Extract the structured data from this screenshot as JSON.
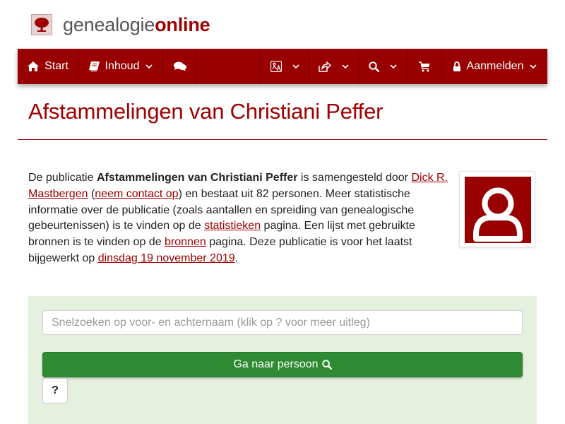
{
  "brand": {
    "part1": "genealogie",
    "part2": "online"
  },
  "nav": {
    "start": "Start",
    "inhoud": "Inhoud",
    "aanmelden": "Aanmelden",
    "icons": [
      "home-icon",
      "book-icon",
      "comments-icon",
      "language-icon",
      "share-icon",
      "search-icon",
      "cart-icon",
      "lock-icon"
    ]
  },
  "page": {
    "title": "Afstammelingen van Christiani Peffer"
  },
  "intro": {
    "t1": "De publicatie ",
    "pub_name": "Afstammelingen van Christiani Peffer",
    "t2": " is samengesteld door ",
    "author": "Dick R. Mastbergen",
    "t3": " (",
    "contact": "neem contact op",
    "t4": ") en bestaat uit 82 personen. Meer statistische informatie over de publicatie (zoals aantallen en spreiding van genealogische gebeurtenissen) is te vinden op de ",
    "stats": "statistieken",
    "t5": " pagina. Een lijst met gebruikte bronnen is te vinden op de ",
    "sources": "bronnen",
    "t6": " pagina. Deze publicatie is voor het laatst bijgewerkt op ",
    "updated": "dinsdag 19 november 2019",
    "t7": "."
  },
  "search": {
    "placeholder": "Snelzoeken op voor- en achternaam (klik op ? voor meer uitleg)",
    "button": "Ga naar persoon",
    "help": "?"
  },
  "colors": {
    "brand_red": "#990000",
    "link_red": "#a00000",
    "panel_green": "#e5f0df",
    "button_green": "#2e8b32"
  }
}
